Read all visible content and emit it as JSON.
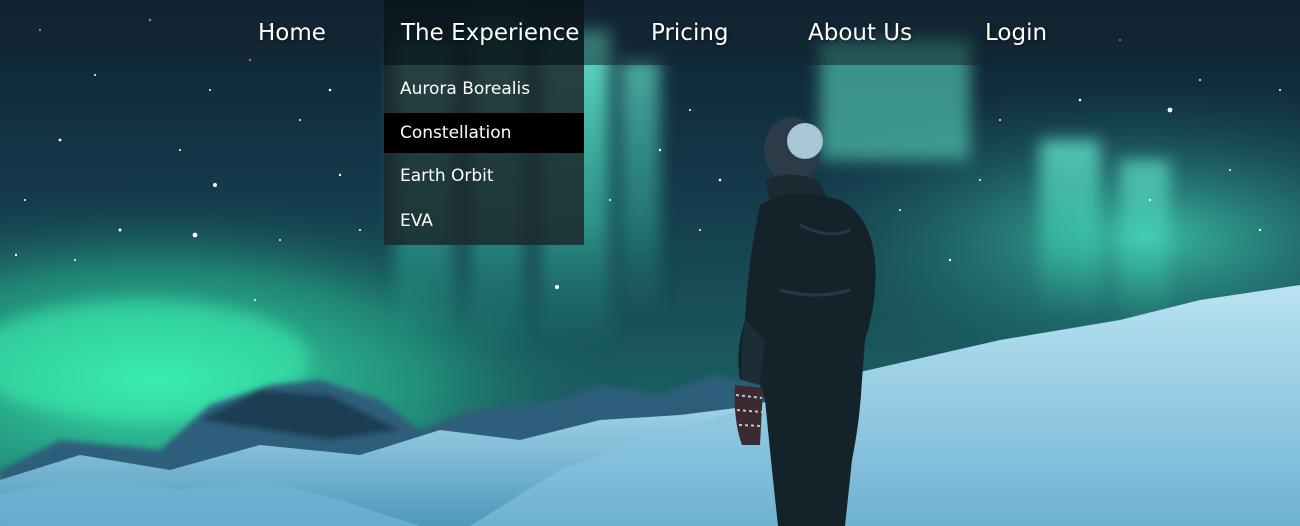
{
  "nav": {
    "items": [
      {
        "label": "Home"
      },
      {
        "label": "The Experience"
      },
      {
        "label": "Pricing"
      },
      {
        "label": "About Us"
      },
      {
        "label": "Login"
      }
    ],
    "active_index": 1
  },
  "dropdown": {
    "items": [
      {
        "label": "Aurora Borealis"
      },
      {
        "label": "Constellation"
      },
      {
        "label": "Earth Orbit"
      },
      {
        "label": "EVA"
      }
    ],
    "hovered_index": 1
  },
  "colors": {
    "nav_bg": "#142630",
    "active_bg": "#0a181c",
    "dropdown_bg": "#1c282c",
    "hover_bg": "#000000",
    "aurora": "#3de8b8",
    "text": "#ffffff"
  }
}
